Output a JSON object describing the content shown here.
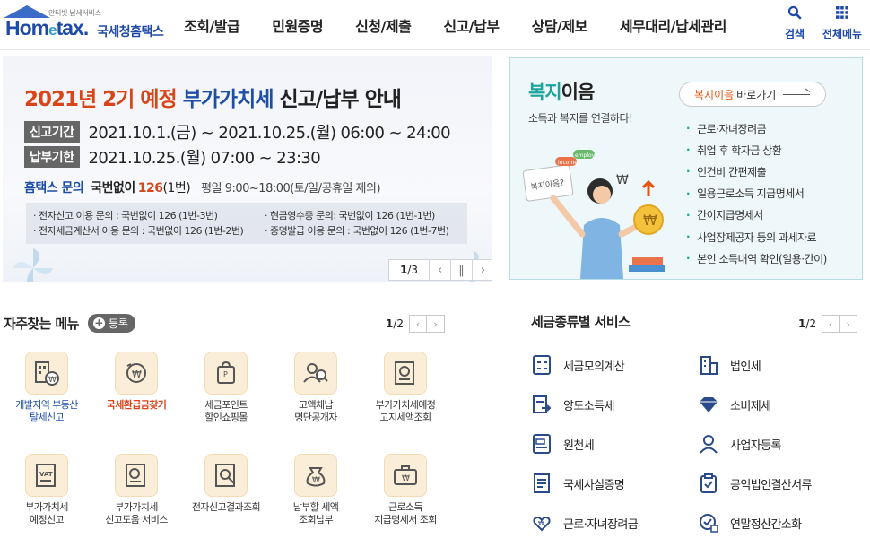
{
  "header": {
    "logo_sub": "안티빗 납세서비스",
    "logo_word_a": "Hom",
    "logo_word_e": "e",
    "logo_word_b": "tax.",
    "logo_kname": "국세청홈택스",
    "nav": [
      "조회/발급",
      "민원증명",
      "신청/제출",
      "신고/납부",
      "상담/제보",
      "세무대리/납세관리"
    ],
    "search_label": "검색",
    "all_menu_label": "전체메뉴"
  },
  "banner": {
    "title_a": "2021년 2기 예정",
    "title_b": "부가가치세",
    "title_c": "신고/납부 안내",
    "period_tag": "신고기간",
    "period_value": "2021.10.1.(금) ~ 2021.10.25.(월) 06:00 ~ 24:00",
    "due_tag": "납부기한",
    "due_value": "2021.10.25.(월) 07:00 ~ 23:30",
    "inquiry_a": "홈택스 문의",
    "inquiry_b": "국번없이",
    "inquiry_c": "126",
    "inquiry_d": "(1번)",
    "inquiry_e": "평일 9:00~18:00(토/일/공휴일 제외)",
    "lines": [
      [
        "· 전자신고 이용 문의 : 국번없이 126 (1번-3번)",
        "· 현금영수증 문의: 국번없이 126 (1번-1번)"
      ],
      [
        "· 전자세금계산서 이용 문의 : 국번없이 126 (1번-2번)",
        "· 증명발급 이용 문의 : 국번없이 126 (1번-7번)"
      ]
    ],
    "page_current": "1",
    "page_total": "/3"
  },
  "welfare": {
    "title_a": "복지",
    "title_b": "이음",
    "subtitle": "소득과 복지를 연결하다!",
    "button_a": "복지이음",
    "button_b": "바로가기",
    "items": [
      "근로·자녀장려금",
      "취업 후 학자금 상환",
      "인건비 간편제출",
      "일용근로소득 지급명세서",
      "간이지급명세서",
      "사업장제공자 등의 과세자료",
      "본인 소득내역 확인(일용·간이)"
    ],
    "sign_text": "복지이음?",
    "bubble1": "income",
    "bubble2": "employ"
  },
  "favorites": {
    "title": "자주찾는 메뉴",
    "register_label": "등록",
    "page_current": "1",
    "page_total": "/2",
    "items": [
      {
        "label_1": "개발지역 부동산",
        "label_2": "탈세신고",
        "style": "blue",
        "icon": "building-report-icon"
      },
      {
        "label_1": "국세환급금찾기",
        "label_2": "",
        "style": "red",
        "icon": "refund-coin-icon"
      },
      {
        "label_1": "세금포인트",
        "label_2": "할인쇼핑몰",
        "style": "",
        "icon": "point-bag-icon"
      },
      {
        "label_1": "고액체납",
        "label_2": "명단공개자",
        "style": "",
        "icon": "people-search-icon"
      },
      {
        "label_1": "부가가치세예정",
        "label_2": "고지세액조회",
        "style": "",
        "icon": "vat-notice-icon"
      },
      {
        "label_1": "부가가치세",
        "label_2": "예정신고",
        "style": "",
        "icon": "vat-document-icon"
      },
      {
        "label_1": "부가가치세",
        "label_2": "신고도움 서비스",
        "style": "",
        "icon": "vat-help-icon"
      },
      {
        "label_1": "전자신고결과조회",
        "label_2": "",
        "style": "",
        "icon": "result-search-icon"
      },
      {
        "label_1": "납부할 세액",
        "label_2": "조회납부",
        "style": "",
        "icon": "money-bag-icon"
      },
      {
        "label_1": "근로소득",
        "label_2": "지급명세서 조회",
        "style": "",
        "icon": "payroll-statement-icon"
      }
    ]
  },
  "tax_services": {
    "title": "세금종류별 서비스",
    "page_current": "1",
    "page_total": "/2",
    "items": [
      {
        "label": "세금모의계산",
        "icon": "calculator-icon"
      },
      {
        "label": "법인세",
        "icon": "corporate-building-icon"
      },
      {
        "label": "양도소득세",
        "icon": "transfer-document-icon"
      },
      {
        "label": "소비제세",
        "icon": "diamond-icon"
      },
      {
        "label": "원천세",
        "icon": "withholding-document-icon"
      },
      {
        "label": "사업자등록",
        "icon": "business-person-icon"
      },
      {
        "label": "국세사실증명",
        "icon": "certificate-icon"
      },
      {
        "label": "공익법인결산서류",
        "icon": "clipboard-icon"
      },
      {
        "label": "근로·자녀장려금",
        "icon": "heart-hands-icon"
      },
      {
        "label": "연말정산간소화",
        "icon": "year-end-settlement-icon"
      }
    ]
  }
}
